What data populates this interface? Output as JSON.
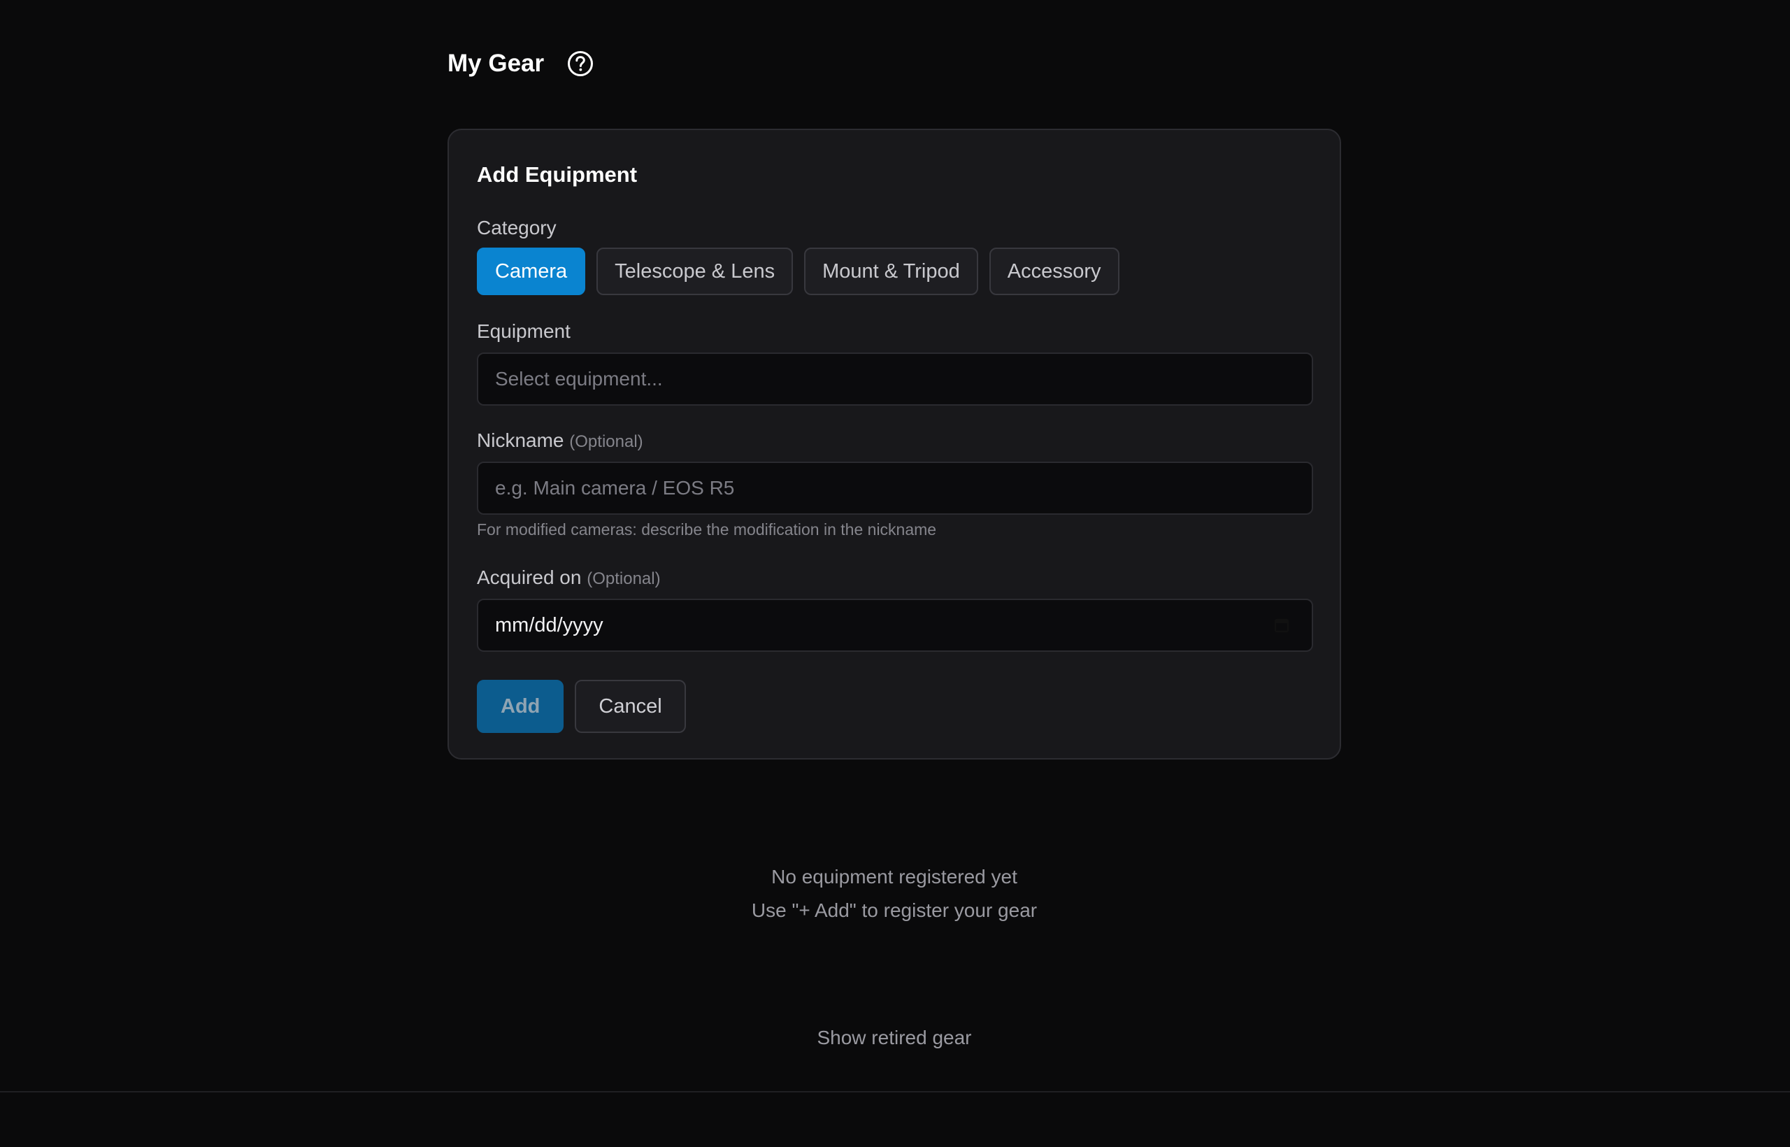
{
  "header": {
    "title": "My Gear",
    "help_icon": "question-circle-icon"
  },
  "form": {
    "title": "Add Equipment",
    "category": {
      "label": "Category",
      "options": [
        "Camera",
        "Telescope & Lens",
        "Mount & Tripod",
        "Accessory"
      ],
      "selected": "Camera"
    },
    "equipment": {
      "label": "Equipment",
      "placeholder": "Select equipment..."
    },
    "nickname": {
      "label": "Nickname",
      "optional": "(Optional)",
      "placeholder": "e.g. Main camera / EOS R5",
      "value": "",
      "hint": "For modified cameras: describe the modification in the nickname"
    },
    "acquired": {
      "label": "Acquired on",
      "optional": "(Optional)",
      "value": "mm/dd/yyyy",
      "icon": "calendar-icon"
    },
    "actions": {
      "add_label": "Add",
      "cancel_label": "Cancel"
    }
  },
  "empty_state": {
    "line1": "No equipment registered yet",
    "line2": "Use \"+ Add\" to register your gear"
  },
  "retired_link": "Show retired gear",
  "colors": {
    "accent": "#0a84d0",
    "background": "#0a0a0b",
    "card": "#18181b"
  }
}
